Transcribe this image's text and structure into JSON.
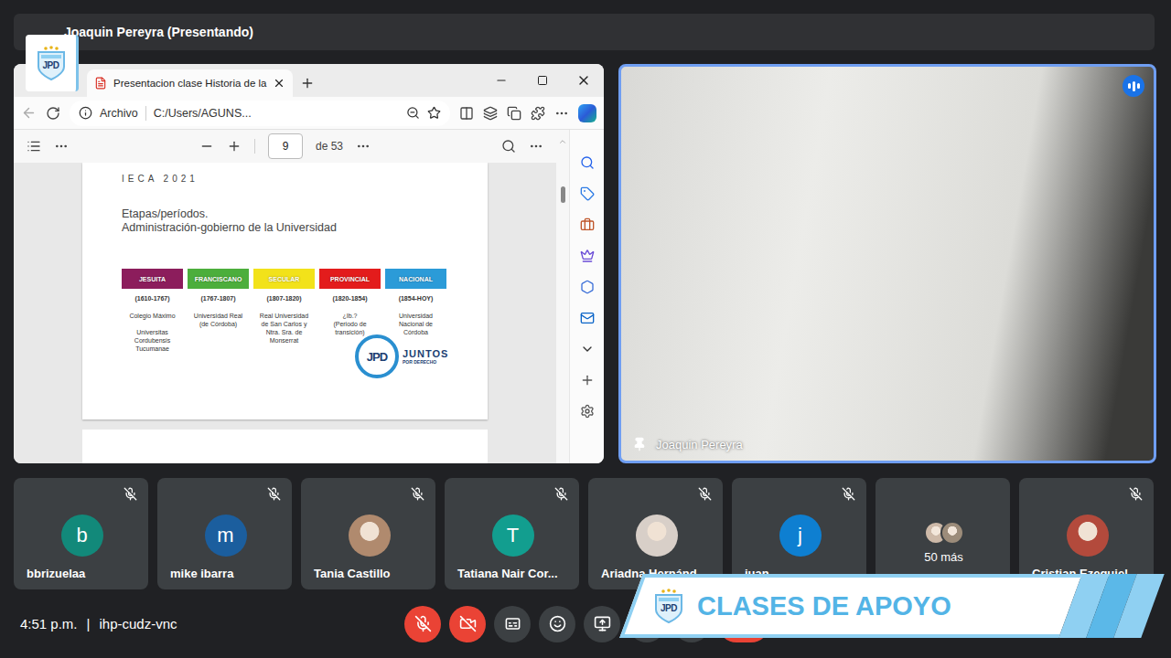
{
  "meeting": {
    "presenter_label": "Joaquin Pereyra (Presentando)",
    "time": "4:51 p.m.",
    "separator": "|",
    "code": "ihp-cudz-vnc"
  },
  "channel_logo": {
    "initials": "JPD"
  },
  "browser": {
    "tab": {
      "title": "Presentacion clase Historia de la",
      "selected": true
    },
    "address": {
      "scheme": "Archivo",
      "path": "C:/Users/AGUNS..."
    },
    "pdf_toolbar": {
      "page": "9",
      "page_count": "de 53"
    }
  },
  "slide": {
    "header": "IECA 2021",
    "title_lines": [
      "Etapas/períodos.",
      "Administración-gobierno de la Universidad"
    ],
    "periods": [
      {
        "name": "JESUITA",
        "years": "(1610-1767)",
        "blocks": [
          [
            "Colegio Máximo"
          ],
          [
            "Universitas",
            "Cordubensis",
            "Tucumanae"
          ]
        ],
        "color": "#8c1d5c"
      },
      {
        "name": "FRANCISCANO",
        "years": "(1767-1807)",
        "blocks": [
          [
            "Universidad Real",
            "(de Córdoba)"
          ]
        ],
        "color": "#4cae3c"
      },
      {
        "name": "SECULAR",
        "years": "(1807-1820)",
        "blocks": [
          [
            "Real Universidad",
            "de San Carlos y",
            "Ntra. Sra. de",
            "Monserrat"
          ]
        ],
        "color": "#f2e21a"
      },
      {
        "name": "PROVINCIAL",
        "years": "(1820-1854)",
        "blocks": [
          [
            "¿Ib.?",
            "(Periodo de",
            "transición)"
          ]
        ],
        "color": "#e31c1c"
      },
      {
        "name": "NACIONAL",
        "years": "(1854-HOY)",
        "blocks": [
          [
            "Universidad",
            "Nacional de",
            "Córdoba"
          ]
        ],
        "color": "#2b9bd8"
      }
    ],
    "logo": {
      "initials": "JPD",
      "name": "JUNTOS",
      "subtitle": "POR DERECHO"
    }
  },
  "speaker": {
    "name": "Joaquin Pereyra",
    "pinned": true,
    "speaking": true
  },
  "participants": [
    {
      "kind": "initial",
      "name": "bbrizuelaa",
      "initial": "b",
      "color": "#12897a",
      "muted": true
    },
    {
      "kind": "initial",
      "name": "mike ibarra",
      "initial": "m",
      "color": "#1b5e9e",
      "muted": true
    },
    {
      "kind": "photo",
      "name": "Tania Castillo",
      "color": "#b08a6e",
      "muted": true
    },
    {
      "kind": "initial",
      "name": "Tatiana Nair Cor...",
      "initial": "T",
      "color": "#129e8f",
      "muted": true
    },
    {
      "kind": "photo",
      "name": "Ariadna Hernánd...",
      "color": "#d8cfc8",
      "muted": true
    },
    {
      "kind": "initial",
      "name": "juan",
      "initial": "j",
      "color": "#0e7fd1",
      "muted": true
    },
    {
      "kind": "overflow",
      "label": "50 más",
      "colors": [
        "#cdb9a8",
        "#9c8c7a"
      ],
      "muted": false
    },
    {
      "kind": "photo",
      "name": "Cristian Ezequiel",
      "color": "#b34a3c",
      "muted": true
    }
  ],
  "controls": [
    {
      "kind": "mic",
      "on": false
    },
    {
      "kind": "camera",
      "on": false
    },
    {
      "kind": "captions",
      "on": false
    },
    {
      "kind": "reactions",
      "on": false
    },
    {
      "kind": "present",
      "on": false
    },
    {
      "kind": "hand",
      "on": false
    },
    {
      "kind": "more",
      "on": false
    },
    {
      "kind": "leave",
      "on": true
    }
  ],
  "banner": {
    "text": "CLASES DE APOYO"
  }
}
